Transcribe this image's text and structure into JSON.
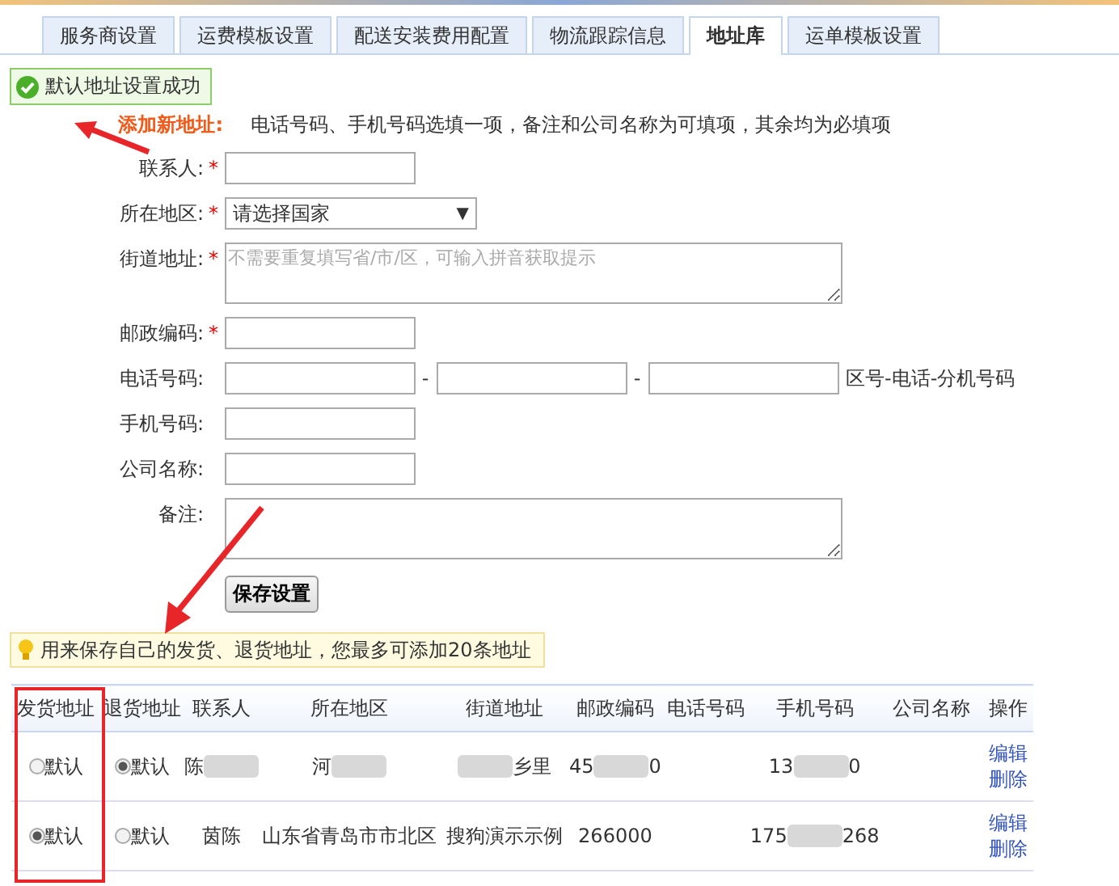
{
  "tabs": [
    {
      "label": "服务商设置",
      "selected": false
    },
    {
      "label": "运费模板设置",
      "selected": false
    },
    {
      "label": "配送安装费用配置",
      "selected": false
    },
    {
      "label": "物流跟踪信息",
      "selected": false
    },
    {
      "label": "地址库",
      "selected": true
    },
    {
      "label": "运单模板设置",
      "selected": false
    }
  ],
  "success_message": "默认地址设置成功",
  "form": {
    "title": "添加新地址:",
    "hint": "电话号码、手机号码选填一项，备注和公司名称为可填项，其余均为必填项",
    "fields": [
      {
        "label": "联系人:",
        "required": true,
        "kind": "input"
      },
      {
        "label": "所在地区:",
        "required": true,
        "kind": "select",
        "value": "请选择国家",
        "caret": "▼"
      },
      {
        "label": "街道地址:",
        "required": true,
        "kind": "textarea",
        "placeholder": "不需要重复填写省/市/区，可输入拼音获取提示"
      },
      {
        "label": "邮政编码:",
        "required": true,
        "kind": "input"
      },
      {
        "label": "电话号码:",
        "required": false,
        "kind": "phone",
        "separators": [
          "-",
          "-"
        ],
        "suffix": "区号-电话-分机号码"
      },
      {
        "label": "手机号码:",
        "required": false,
        "kind": "input"
      },
      {
        "label": "公司名称:",
        "required": false,
        "kind": "input"
      },
      {
        "label": "备注:",
        "required": false,
        "kind": "textarea"
      }
    ],
    "required_mark": "*",
    "save_button": "保存设置"
  },
  "tip": "用来保存自己的发货、退货地址，您最多可添加20条地址",
  "table": {
    "columns": [
      "发货地址",
      "退货地址",
      "联系人",
      "所在地区",
      "街道地址",
      "邮政编码",
      "电话号码",
      "手机号码",
      "公司名称",
      "操作"
    ],
    "rows": [
      {
        "cells": [
          {
            "kind": "radio",
            "text": "默认",
            "selected": false
          },
          {
            "kind": "radio",
            "text": "默认",
            "selected": true
          },
          {
            "kind": "text",
            "text": "陈",
            "redacted": true
          },
          {
            "kind": "text",
            "text": "河",
            "redacted": true
          },
          {
            "kind": "text",
            "redacted": true,
            "end": "乡里"
          },
          {
            "kind": "text",
            "text": "45",
            "redacted": true,
            "end": "0"
          },
          {
            "kind": "text",
            "text": ""
          },
          {
            "kind": "text",
            "text": "13",
            "redacted": true,
            "end": "0"
          },
          {
            "kind": "text",
            "text": ""
          },
          {
            "kind": "actions",
            "links": [
              "编辑",
              "删除"
            ]
          }
        ]
      },
      {
        "cells": [
          {
            "kind": "radio",
            "text": "默认",
            "selected": true
          },
          {
            "kind": "radio",
            "text": "默认",
            "selected": false
          },
          {
            "kind": "text",
            "text": "茵陈",
            "redacted": false
          },
          {
            "kind": "text",
            "text": "山东省青岛市市北区",
            "redacted": false
          },
          {
            "kind": "text",
            "text": "搜狗演示示例",
            "redacted": false
          },
          {
            "kind": "text",
            "text": "266000",
            "redacted": false
          },
          {
            "kind": "text",
            "text": ""
          },
          {
            "kind": "text",
            "text": "175",
            "redacted": true,
            "end": "268"
          },
          {
            "kind": "text",
            "text": ""
          },
          {
            "kind": "actions",
            "links": [
              "编辑",
              "删除"
            ]
          }
        ]
      }
    ]
  }
}
